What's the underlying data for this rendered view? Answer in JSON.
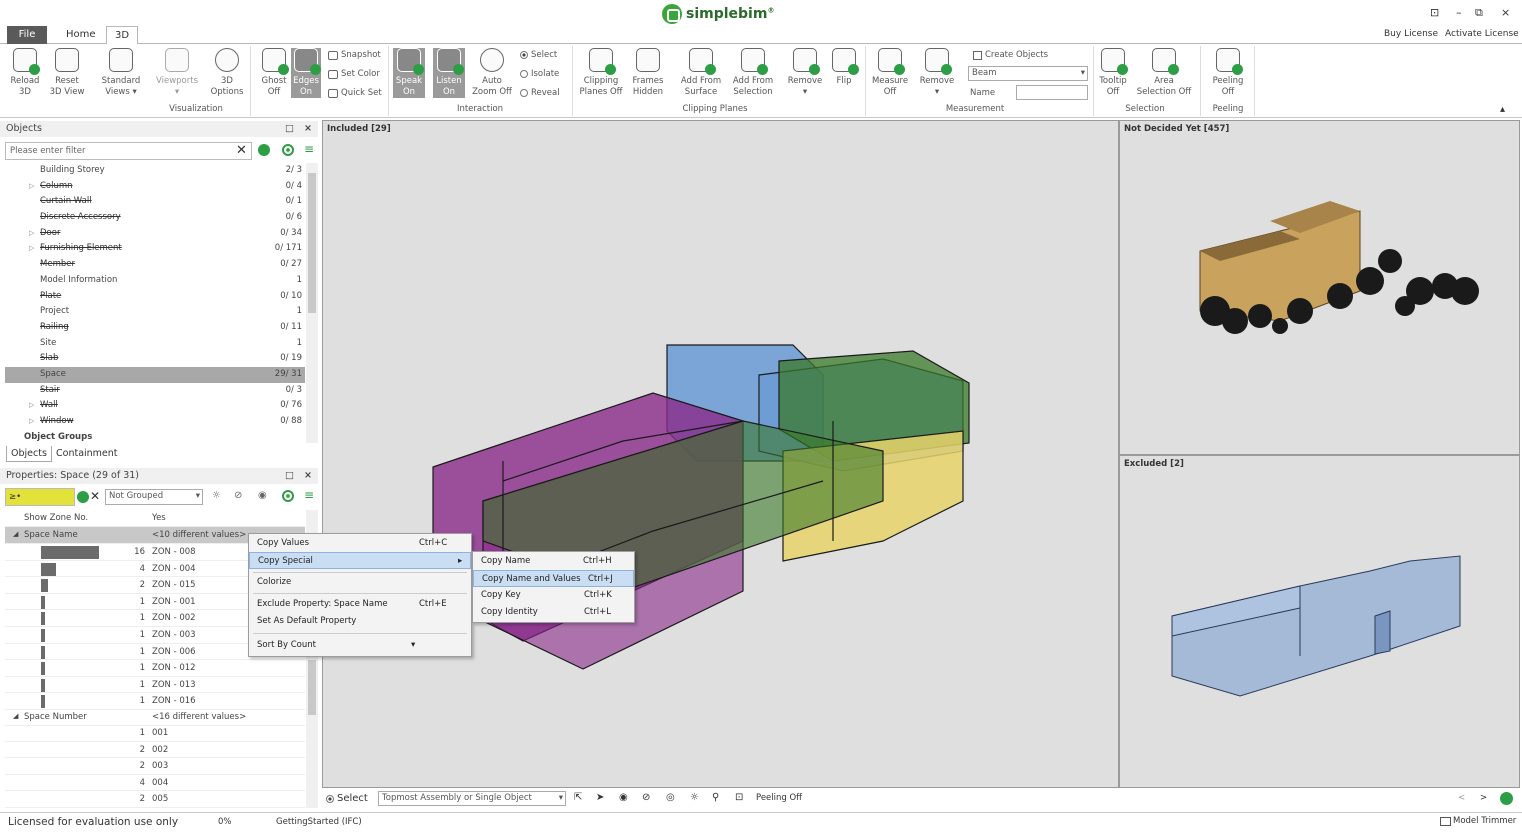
{
  "app": {
    "name": "simplebim",
    "trademark": "®"
  },
  "window": {
    "restore_icon": "⊡",
    "minimize_icon": "–",
    "maximize_icon": "⧉",
    "close_icon": "×"
  },
  "tabs": {
    "file": "File",
    "home": "Home",
    "three_d": "3D"
  },
  "top_links": {
    "buy": "Buy License",
    "activate": "Activate License"
  },
  "ribbon": {
    "reload": "Reload 3D",
    "reset": "Reset 3D View",
    "standard": "Standard Views ▾",
    "viewports": "Viewports",
    "viewports_arrow": "▾",
    "options": "3D Options",
    "ghost": "Ghost Off",
    "edges": "Edges On",
    "snapshot": "Snapshot",
    "set_color": "Set Color",
    "quick_set": "Quick Set",
    "group_visualization": "Visualization",
    "speak": "Speak On",
    "listen": "Listen On",
    "auto_zoom": "Auto Zoom Off",
    "select": "Select",
    "isolate": "Isolate",
    "reveal": "Reveal",
    "group_interaction": "Interaction",
    "clipping": "Clipping Planes Off",
    "frames": "Frames Hidden",
    "add_surface": "Add From Surface",
    "add_selection": "Add From Selection",
    "remove": "Remove",
    "remove_arrow": "▾",
    "flip": "Flip",
    "group_clipping": "Clipping Planes",
    "measure": "Measure Off",
    "remove_measure": "Remove",
    "remove_measure_arrow": "▾",
    "create_objects": "Create Objects",
    "beam": "Beam",
    "name_label": "Name",
    "group_measurement": "Measurement",
    "tooltip": "Tooltip Off",
    "area_selection": "Area Selection Off",
    "group_selection": "Selection",
    "peeling": "Peeling Off",
    "group_peeling": "Peeling",
    "collapse_icon": "▴"
  },
  "objects_panel": {
    "title": "Objects",
    "filter_placeholder": "Please enter filter",
    "items": [
      {
        "name": "Building Storey",
        "count": "2/ 3",
        "strike": false,
        "arrow": ""
      },
      {
        "name": "Column",
        "count": "0/ 4",
        "strike": true,
        "arrow": "▷"
      },
      {
        "name": "Curtain Wall",
        "count": "0/ 1",
        "strike": true,
        "arrow": ""
      },
      {
        "name": "Discrete Accessory",
        "count": "0/ 6",
        "strike": true,
        "arrow": ""
      },
      {
        "name": "Door",
        "count": "0/ 34",
        "strike": true,
        "arrow": "▷"
      },
      {
        "name": "Furnishing Element",
        "count": "0/ 171",
        "strike": true,
        "arrow": "▷"
      },
      {
        "name": "Member",
        "count": "0/ 27",
        "strike": true,
        "arrow": ""
      },
      {
        "name": "Model Information",
        "count": "1",
        "strike": false,
        "arrow": ""
      },
      {
        "name": "Plate",
        "count": "0/ 10",
        "strike": true,
        "arrow": ""
      },
      {
        "name": "Project",
        "count": "1",
        "strike": false,
        "arrow": ""
      },
      {
        "name": "Railing",
        "count": "0/ 11",
        "strike": true,
        "arrow": ""
      },
      {
        "name": "Site",
        "count": "1",
        "strike": false,
        "arrow": ""
      },
      {
        "name": "Slab",
        "count": "0/ 19",
        "strike": true,
        "arrow": ""
      },
      {
        "name": "Space",
        "count": "29/ 31",
        "strike": false,
        "arrow": "",
        "selected": true
      },
      {
        "name": "Stair",
        "count": "0/ 3",
        "strike": true,
        "arrow": ""
      },
      {
        "name": "Wall",
        "count": "0/ 76",
        "strike": true,
        "arrow": "▷"
      },
      {
        "name": "Window",
        "count": "0/ 88",
        "strike": true,
        "arrow": "▷"
      }
    ],
    "object_groups": "Object Groups",
    "tab_objects": "Objects",
    "tab_containment": "Containment"
  },
  "properties_panel": {
    "title": "Properties: Space (29 of 31)",
    "filter_value": "≥•",
    "grouping": "Not Grouped",
    "show_zone_label": "Show Zone No.",
    "show_zone_value": "Yes",
    "space_name_label": "Space Name",
    "space_name_value": "<10 different values>",
    "space_name_rows": [
      {
        "count": "16",
        "value": "ZON - 008",
        "fraction": 1.0
      },
      {
        "count": "4",
        "value": "ZON - 004",
        "fraction": 0.25
      },
      {
        "count": "2",
        "value": "ZON - 015",
        "fraction": 0.125
      },
      {
        "count": "1",
        "value": "ZON - 001",
        "fraction": 0.0625
      },
      {
        "count": "1",
        "value": "ZON - 002",
        "fraction": 0.0625
      },
      {
        "count": "1",
        "value": "ZON - 003",
        "fraction": 0.0625
      },
      {
        "count": "1",
        "value": "ZON - 006",
        "fraction": 0.0625
      },
      {
        "count": "1",
        "value": "ZON - 012",
        "fraction": 0.0625
      },
      {
        "count": "1",
        "value": "ZON - 013",
        "fraction": 0.0625
      },
      {
        "count": "1",
        "value": "ZON - 016",
        "fraction": 0.0625
      }
    ],
    "space_number_label": "Space Number",
    "space_number_value": "<16 different values>",
    "space_number_rows": [
      {
        "count": "1",
        "value": "001"
      },
      {
        "count": "2",
        "value": "002"
      },
      {
        "count": "2",
        "value": "003"
      },
      {
        "count": "4",
        "value": "004"
      },
      {
        "count": "2",
        "value": "005"
      }
    ]
  },
  "context_menu": {
    "copy_values": "Copy Values",
    "copy_values_sc": "Ctrl+C",
    "copy_special": "Copy Special",
    "copy_special_arrow": "▸",
    "colorize": "Colorize",
    "exclude": "Exclude Property: Space Name",
    "exclude_sc": "Ctrl+E",
    "set_default": "Set As Default Property",
    "sort": "Sort By Count",
    "sort_arrow": "▾"
  },
  "submenu": {
    "copy_name": "Copy Name",
    "copy_name_sc": "Ctrl+H",
    "copy_name_values": "Copy Name and Values",
    "copy_name_values_sc": "Ctrl+J",
    "copy_key": "Copy Key",
    "copy_key_sc": "Ctrl+K",
    "copy_identity": "Copy Identity",
    "copy_identity_sc": "Ctrl+L"
  },
  "viewports": {
    "included": "Included [29]",
    "not_decided": "Not Decided Yet [457]",
    "excluded": "Excluded [2]"
  },
  "bottom_bar": {
    "select": "Select",
    "mode": "Topmost Assembly or Single Object",
    "peeling": "Peeling Off",
    "prev": "<",
    "next": ">"
  },
  "status": {
    "license": "Licensed for evaluation use only",
    "percent": "0%",
    "file": "GettingStarted (IFC)",
    "trimmer": "Model Trimmer"
  },
  "colors": {
    "accent_green": "#2e9e46",
    "selected_row": "#a8a8a8",
    "menu_highlight": "#c9ddf3",
    "space_purple": "#8a2a8a",
    "space_green": "#3a7a2a",
    "space_blue": "#6a9ad6",
    "space_yellow": "#e8d46a"
  }
}
